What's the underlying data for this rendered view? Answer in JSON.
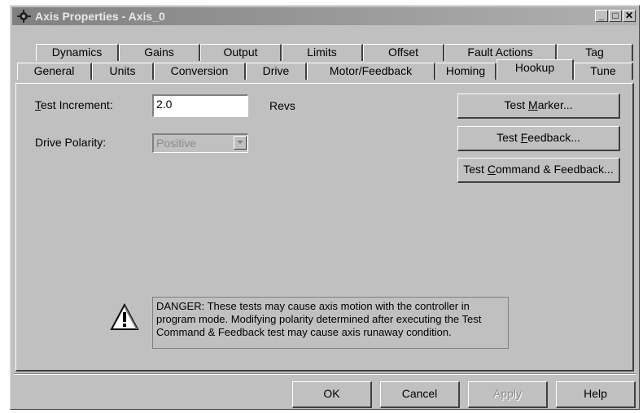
{
  "window": {
    "title": "Axis Properties - Axis_0",
    "icon": "axis-gear-icon",
    "controls": [
      "_",
      "□",
      "✕"
    ]
  },
  "tabs_row_back": [
    "Dynamics",
    "Gains",
    "Output",
    "Limits",
    "Offset",
    "Fault Actions",
    "Tag"
  ],
  "tabs_row_front": [
    "General",
    "Units",
    "Conversion",
    "Drive",
    "Motor/Feedback",
    "Homing",
    "Hookup",
    "Tune"
  ],
  "active_tab": "Hookup",
  "form": {
    "test_increment_label_pre": "",
    "test_increment_label_underline": "T",
    "test_increment_label_post": "est Increment:",
    "test_increment_value": "2.0",
    "test_increment_unit": "Revs",
    "drive_polarity_label": "Drive Polarity:",
    "drive_polarity_value": "Positive"
  },
  "side_buttons": {
    "test_marker": {
      "pre": "Test ",
      "u": "M",
      "post": "arker..."
    },
    "test_feedback": {
      "pre": "Test ",
      "u": "F",
      "post": "eedback..."
    },
    "test_cmd_feedback": {
      "pre": "Test ",
      "u": "C",
      "post": "ommand & Feedback..."
    }
  },
  "warning": {
    "icon": "warning-icon",
    "line1": "DANGER: These tests may cause axis motion with the controller in",
    "line2": "program mode. Modifying polarity determined after executing the Test",
    "line3": "Command & Feedback test may cause axis runaway condition."
  },
  "bottom_buttons": {
    "ok": "OK",
    "cancel": "Cancel",
    "apply": "Apply",
    "help": "Help"
  }
}
